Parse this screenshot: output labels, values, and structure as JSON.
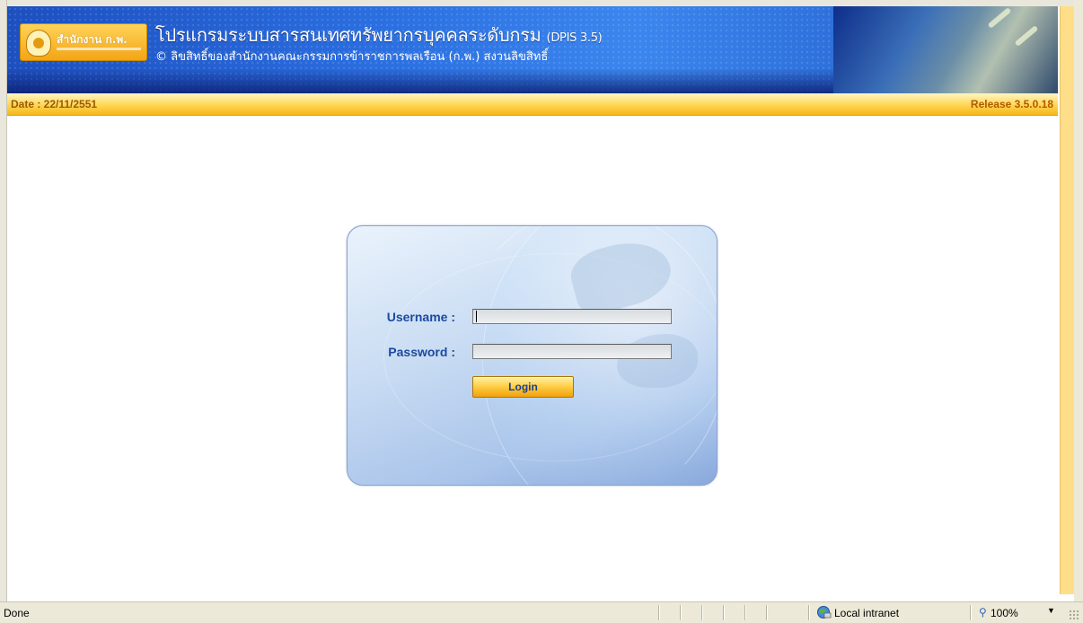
{
  "header": {
    "logo_text": "สำนักงาน ก.พ.",
    "app_title": "โปรแกรมระบบสารสนเทศทรัพยากรบุคคลระดับกรม",
    "app_title_suffix": "(DPIS 3.5)",
    "copyright": "© ลิขสิทธิ์ของสำนักงานคณะกรรมการข้าราชการพลเรือน (ก.พ.) สงวนลิขสิทธิ์"
  },
  "infobar": {
    "date": "Date : 22/11/2551",
    "release": "Release 3.5.0.18"
  },
  "login": {
    "username_label": "Username :",
    "username_value": "",
    "password_label": "Password :",
    "password_value": "",
    "login_button": "Login"
  },
  "statusbar": {
    "status": "Done",
    "zone": "Local intranet",
    "zoom": "100%"
  },
  "colors": {
    "banner_blue": "#2a6ee0",
    "infobar_yellow": "#ffd24a",
    "label_blue": "#1c4aa0",
    "button_orange": "#f2a10c"
  }
}
